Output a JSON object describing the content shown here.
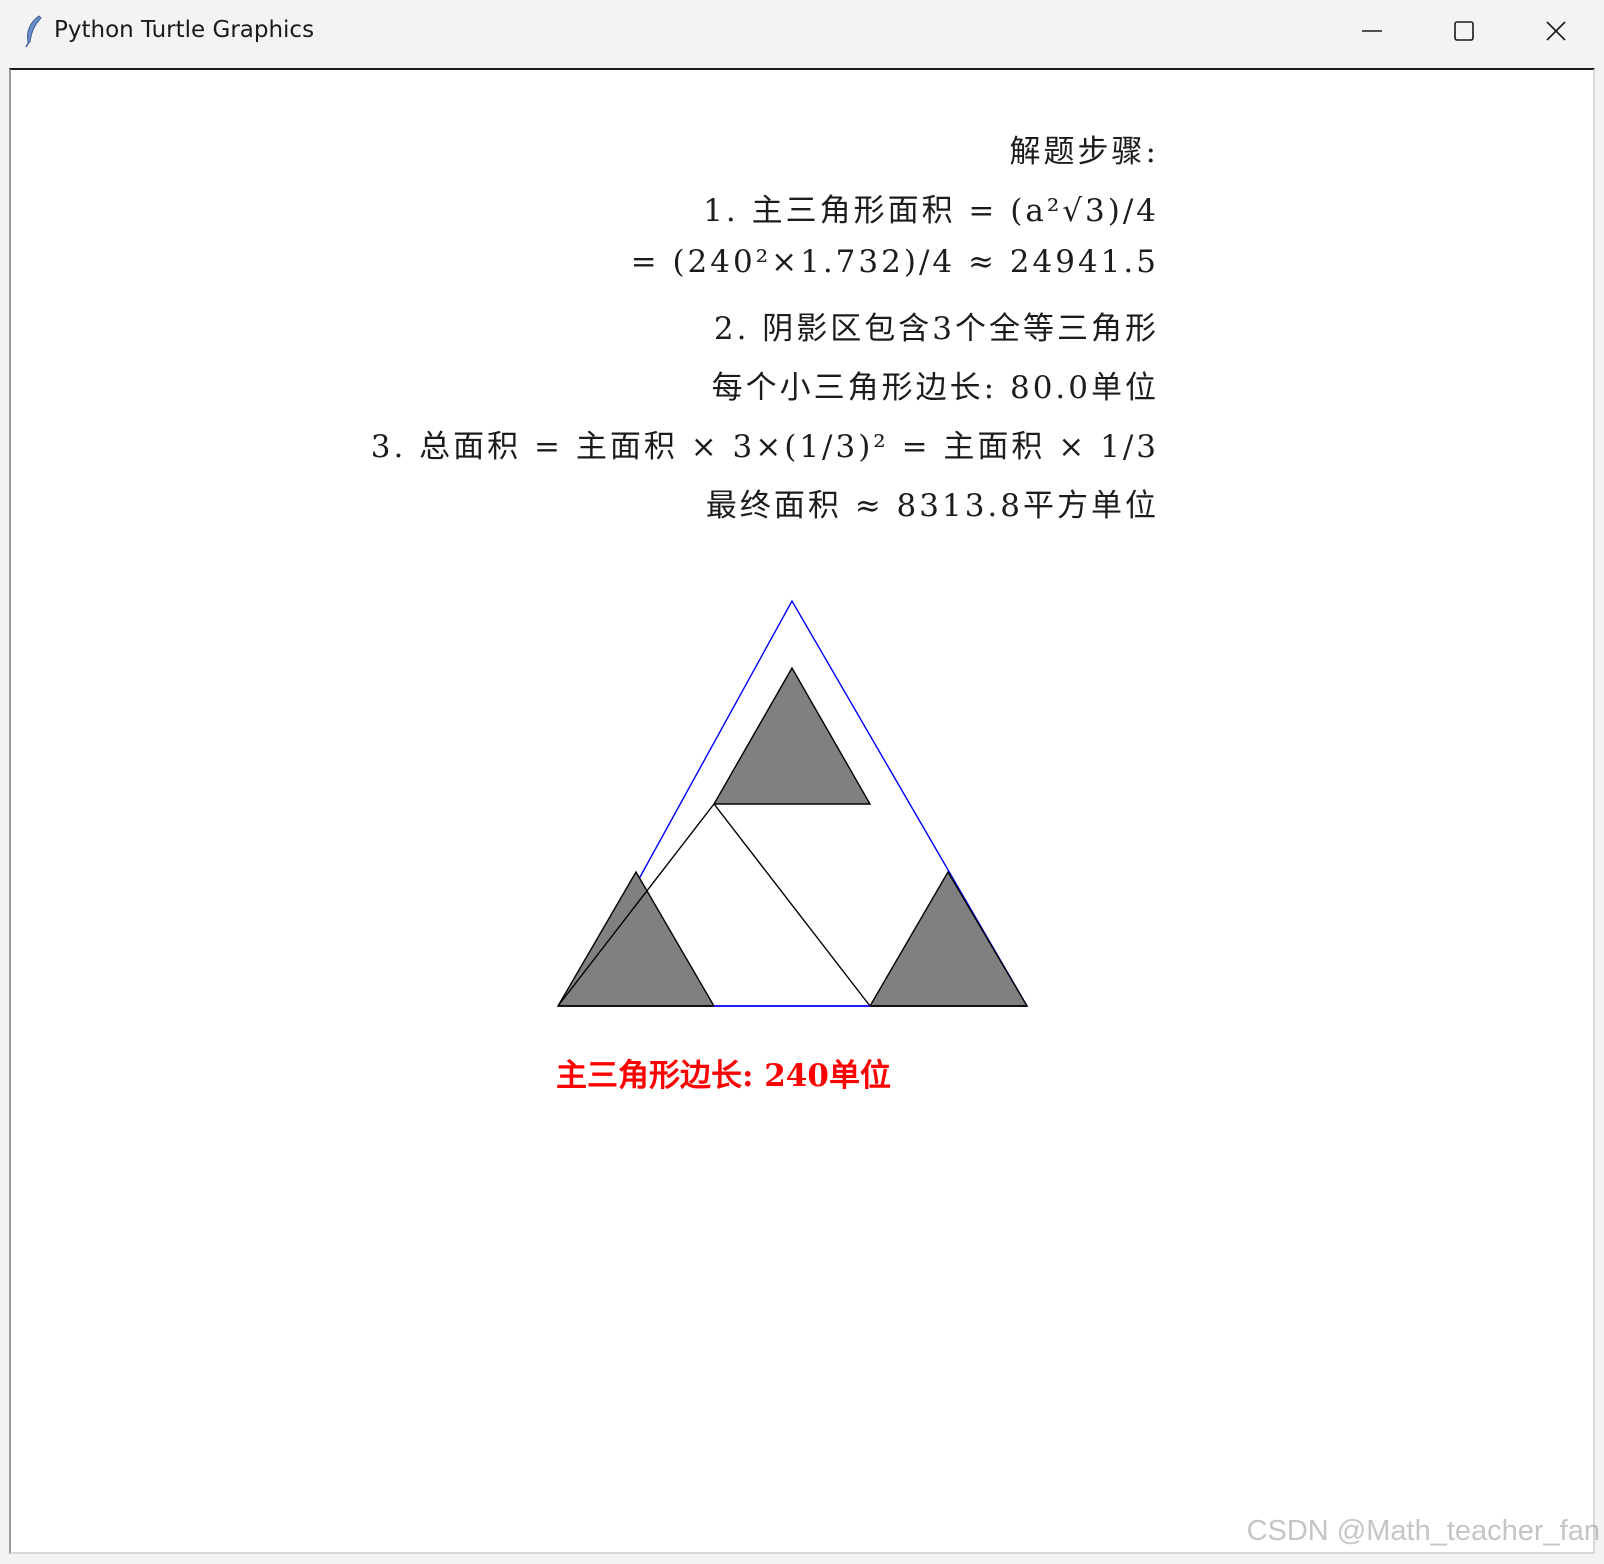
{
  "window": {
    "title": "Python Turtle Graphics",
    "icon": "feather-icon",
    "controls": [
      "minimize-icon",
      "maximize-icon",
      "close-icon"
    ]
  },
  "canvas": {
    "steps": [
      "解题步骤:",
      "1.  主三角形面积 = (a²√3)/4",
      "= (240²×1.732)/4 ≈ 24941.5",
      "2.  阴影区包含3个全等三角形",
      "每个小三角形边长: 80.0单位",
      "3.  总面积 = 主面积 × 3×(1/3)² = 主面积 × 1/3",
      "最终面积 ≈ 8313.8平方单位"
    ],
    "side_label": "主三角形边长: 240单位",
    "colors": {
      "outline": "#0000ff",
      "shaded_fill": "#808080",
      "line": "#000000",
      "label": "#ff0000"
    }
  },
  "watermark": "CSDN @Math_teacher_fan"
}
